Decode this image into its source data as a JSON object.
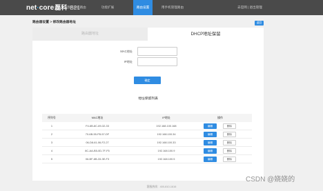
{
  "brand": {
    "prefix": "net",
    "sep": "·",
    "suffix": "core",
    "cn": "磊科",
    "model": "B21"
  },
  "nav": {
    "items": [
      "我的家庭路由",
      "功能扩展",
      "路由设置",
      "用手机管理路由"
    ],
    "active_index": 2,
    "right": "去官网 | 退出管理"
  },
  "breadcrumb": "路由器设置 > 修改路由器地址",
  "return_label": "返回",
  "tabs": {
    "inactive": "路由器地址",
    "active": "DHCP地址保留"
  },
  "form": {
    "mac_label": "MAC地址",
    "mac_value": "",
    "ip_label": "IP地址",
    "ip_value": "",
    "confirm_label": "确定"
  },
  "list_title": "地址保留列表",
  "table": {
    "headers": [
      "序列号",
      "MAC地址",
      "IP地址",
      "操作"
    ],
    "edit_label": "编辑",
    "delete_label": "删除",
    "rows": [
      {
        "no": "1",
        "mac": "F4-6B-8C-89-32-33",
        "ip": "192.168.100.168"
      },
      {
        "no": "2",
        "mac": "70-6B-55-FB-57-DF",
        "ip": "192.168.100.34"
      },
      {
        "no": "3",
        "mac": "06-D8-61-06-F2-27",
        "ip": "192.168.100.33"
      },
      {
        "no": "4",
        "mac": "8C-AA-B5-0D-7F-F5",
        "ip": "192.168.100.9"
      },
      {
        "no": "5",
        "mac": "06-BF-8B-33-3E-F3",
        "ip": "192.168.100.5"
      }
    ]
  },
  "footer": "客服热线：400-810-1616",
  "watermark": "CSDN @娆娆的",
  "colors": {
    "accent": "#2f8ce2",
    "topbar": "#4a4a4a"
  }
}
